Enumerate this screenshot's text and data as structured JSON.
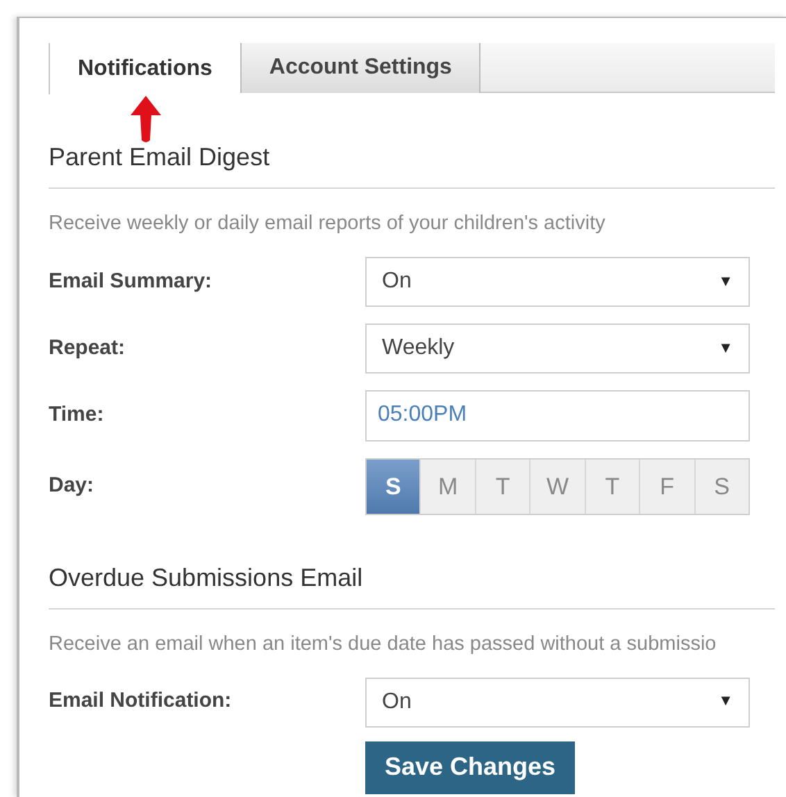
{
  "tabs": [
    {
      "label": "Notifications",
      "selected": true
    },
    {
      "label": "Account Settings",
      "selected": false
    }
  ],
  "sections": [
    {
      "heading": "Parent Email Digest",
      "description": "Receive weekly or daily email reports of your children's activity",
      "fields": [
        {
          "kind": "select",
          "label": "Email Summary:",
          "value": "On"
        },
        {
          "kind": "select",
          "label": "Repeat:",
          "value": "Weekly"
        },
        {
          "kind": "text",
          "label": "Time:",
          "value": "05:00PM"
        },
        {
          "kind": "days",
          "label": "Day:",
          "days": [
            {
              "label": "S",
              "selected": true
            },
            {
              "label": "M",
              "selected": false
            },
            {
              "label": "T",
              "selected": false
            },
            {
              "label": "W",
              "selected": false
            },
            {
              "label": "T",
              "selected": false
            },
            {
              "label": "F",
              "selected": false
            },
            {
              "label": "S",
              "selected": false
            }
          ]
        }
      ]
    },
    {
      "heading": "Overdue Submissions Email",
      "description": "Receive an email when an item's due date has passed without a submissio",
      "fields": [
        {
          "kind": "select",
          "label": "Email Notification:",
          "value": "On"
        }
      ]
    }
  ],
  "save_button": "Save Changes",
  "dropdown_glyph": "▼"
}
